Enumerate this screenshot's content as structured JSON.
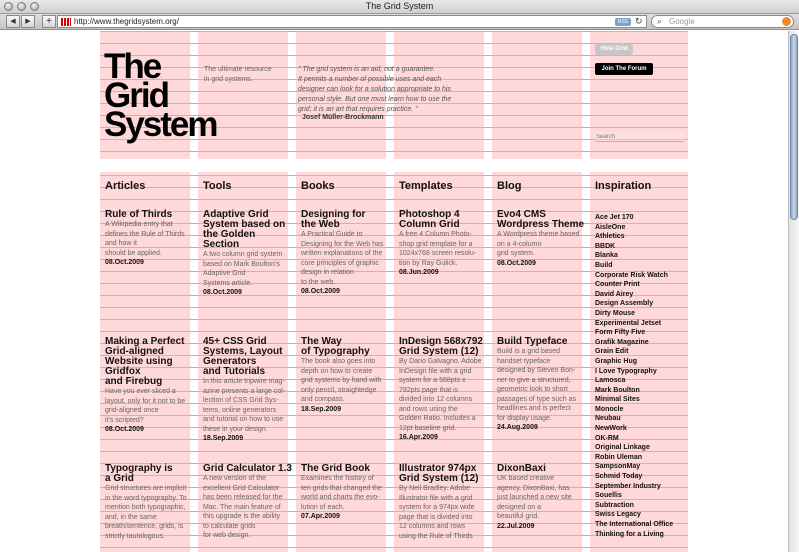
{
  "window": {
    "title": "The Grid System"
  },
  "toolbar": {
    "url": "http://www.thegridsystem.org/",
    "rss": "RSS",
    "search_placeholder": "Google"
  },
  "header": {
    "logo_lines": [
      "The",
      "Grid",
      "System"
    ],
    "intro_lines": [
      "The ultimate resource",
      "in grid systems."
    ],
    "quote_lines": [
      "\" The grid system is an aid, not a guarantee.",
      "It permits a number of possible uses and each",
      "designer can look for a solution appropriate to his",
      "personal style. But one must learn how to use the",
      "grid; it is an art that requires practice. \""
    ],
    "quote_author": "Josef Müller-Brockmann",
    "hide_grid": "Hide Grid",
    "join_forum": "Join The Forum",
    "search_placeholder": "Search"
  },
  "sections": {
    "articles": "Articles",
    "tools": "Tools",
    "books": "Books",
    "templates": "Templates",
    "blog": "Blog",
    "inspiration": "Inspiration"
  },
  "columns": [
    [
      {
        "title": [
          "Rule of Thirds"
        ],
        "desc": [
          "A Wikipedia entry that",
          "defines the Rule of Thirds",
          "and how it",
          "should be applied."
        ],
        "date": "08.Oct.2009"
      },
      {
        "title": [
          "Making a Perfect",
          "Grid-aligned",
          "Website using",
          "Gridfox",
          "and Firebug"
        ],
        "desc": [
          "Have you ever sliced a",
          "layout, only for it not to be",
          "grid-aligned once",
          "it's scripted?"
        ],
        "date": "08.Oct.2009"
      },
      {
        "title": [
          "Typography is",
          "a Grid"
        ],
        "desc": [
          "Grid structures are implicit",
          "in the word typography. To",
          "mention both typographic,",
          "and, in the same",
          "breath/sentence, grids, is",
          "strictly tautologous."
        ],
        "date": ""
      }
    ],
    [
      {
        "title": [
          "Adaptive Grid",
          "System based on",
          "the Golden Section"
        ],
        "desc": [
          "A two column grid system",
          "based on Mark Boulton's",
          "Adaptive Grid",
          "Systems article."
        ],
        "date": "08.Oct.2009"
      },
      {
        "title": [
          "45+ CSS Grid",
          "Systems, Layout",
          "Generators",
          "and Tutorials"
        ],
        "desc": [
          "In this article tripwire mag-",
          "azine presents a large col-",
          "lection of CSS Grid Sys-",
          "tems, online generators",
          "and tutorial on how to use",
          "these in your design."
        ],
        "date": "18.Sep.2009"
      },
      {
        "title": [
          "Grid Calculator 1.3"
        ],
        "desc": [
          "A new version of the",
          "excellent Grid Calculator",
          "has been released for the",
          "Mac. The main feature of",
          "this upgrade is the ability",
          "to calculate grids",
          "for web design."
        ],
        "date": ""
      }
    ],
    [
      {
        "title": [
          "Designing for",
          "the Web"
        ],
        "desc": [
          "A Practical Guide to",
          "Designing for the Web has",
          "written explanations of the",
          "core principles of graphic",
          "design in relation",
          "to the web."
        ],
        "date": "08.Oct.2009"
      },
      {
        "title": [
          "The Way",
          "of Typography"
        ],
        "desc": [
          "The book also goes into",
          "depth on how to create",
          "grid systems by hand with",
          "only pencil, straightedge",
          "and compass."
        ],
        "date": "18.Sep.2009"
      },
      {
        "title": [
          "The Grid Book"
        ],
        "desc": [
          "Examines the history of",
          "ten grids that changed the",
          "world and charts the evo-",
          "lution of each."
        ],
        "date": "07.Apr.2009"
      }
    ],
    [
      {
        "title": [
          "Photoshop 4",
          "Column Grid"
        ],
        "desc": [
          "A free 4 Column Photo-",
          "shop grid template for a",
          "1024x768 screen resolu-",
          "tion by Ray Gulick."
        ],
        "date": "08.Jun.2009"
      },
      {
        "title": [
          "InDesign 568x792",
          "Grid System (12)"
        ],
        "desc": [
          "By Dario Galvagno. Adobe",
          "InDesign file with a grid",
          "system for a 568pts x",
          "792pts page that is",
          "divided into 12 columns",
          "and rows using the",
          "Golden Ratio. Includes a",
          "12pt baseline grid."
        ],
        "date": "16.Apr.2009"
      },
      {
        "title": [
          "Illustrator 974px",
          "Grid System (12)"
        ],
        "desc": [
          "By Neil Bradley. Adobe",
          "Illustrator file with a grid",
          "system for a 974px wide",
          "page that is divided into",
          "12 columns and rows",
          "using the Rule of Thirds"
        ],
        "date": ""
      }
    ],
    [
      {
        "title": [
          "Evo4 CMS",
          "Wordpress Theme"
        ],
        "desc": [
          "A Wordpress theme based",
          "on a 4-column",
          "grid system."
        ],
        "date": "08.Oct.2009"
      },
      {
        "title": [
          "Build Typeface"
        ],
        "desc": [
          "Build is a grid based",
          "handset typeface",
          "designed by Steven Bon-",
          "ner to give a structured,",
          "geometric look to short",
          "passages of type such as",
          "headlines and is perfect",
          "for display usage."
        ],
        "date": "24.Aug.2009"
      },
      {
        "title": [
          "DixonBaxi"
        ],
        "desc": [
          "UK based creative",
          "agency, DixonBaxi, has",
          "just launched a new site",
          "designed on a",
          "beautiful grid."
        ],
        "date": "22.Jul.2009"
      }
    ]
  ],
  "inspiration": [
    "Ace Jet 170",
    "AisleOne",
    "Athletics",
    "BBDK",
    "Blanka",
    "Build",
    "Corporate Risk Watch",
    "Counter Print",
    "David Airey",
    "Design Assembly",
    "Dirty Mouse",
    "Experimental Jetset",
    "Form Fifty Five",
    "Grafik Magazine",
    "Grain Edit",
    "Graphic Hug",
    "I Love Typography",
    "Lamosca",
    "Mark Boulton",
    "Minimal Sites",
    "Monocle",
    "Neubau",
    "NewWork",
    "OK-RM",
    "Original Linkage",
    "Robin Uleman",
    "SampsonMay",
    "Schmid Today",
    "September Industry",
    "Souellis",
    "Subtraction",
    "Swiss Legacy",
    "The International Office",
    "Thinking for a Living"
  ]
}
